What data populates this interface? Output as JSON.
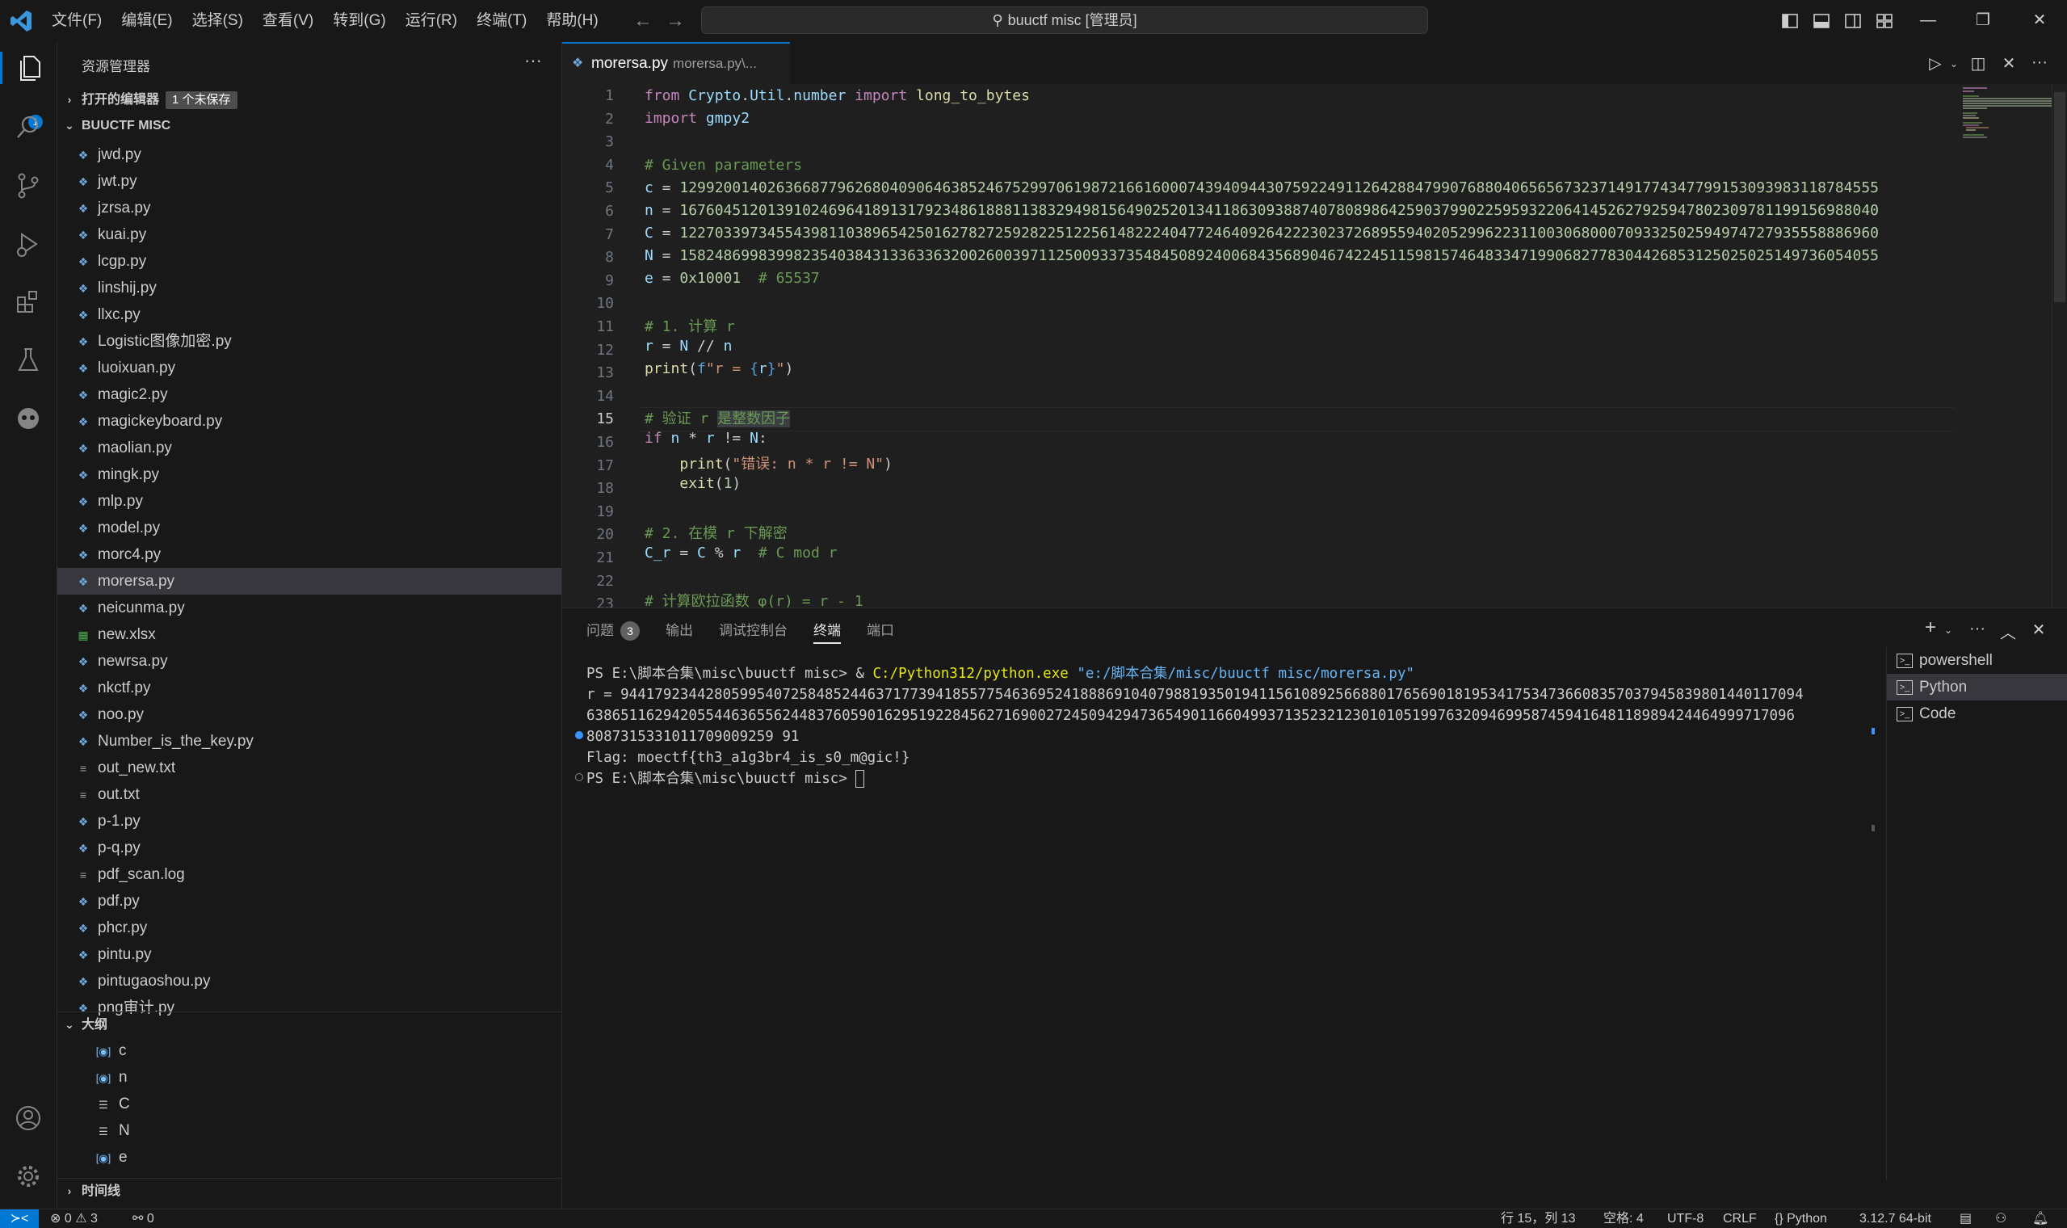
{
  "titlebar": {
    "menus": [
      "文件(F)",
      "编辑(E)",
      "选择(S)",
      "查看(V)",
      "转到(G)",
      "运行(R)",
      "终端(T)",
      "帮助(H)"
    ],
    "search_text": "buuctf misc [管理员]"
  },
  "activitybar": {
    "explorer_badge": "1"
  },
  "sidebar": {
    "title": "资源管理器",
    "open_editors_label": "打开的编辑器",
    "unsaved_badge": "1 个未保存",
    "folder_name": "BUUCTF MISC",
    "files": [
      {
        "name": "jwd.py",
        "type": "py"
      },
      {
        "name": "jwt.py",
        "type": "py"
      },
      {
        "name": "jzrsa.py",
        "type": "py"
      },
      {
        "name": "kuai.py",
        "type": "py"
      },
      {
        "name": "lcgp.py",
        "type": "py"
      },
      {
        "name": "linshij.py",
        "type": "py"
      },
      {
        "name": "llxc.py",
        "type": "py"
      },
      {
        "name": "Logistic图像加密.py",
        "type": "py"
      },
      {
        "name": "luoixuan.py",
        "type": "py"
      },
      {
        "name": "magic2.py",
        "type": "py"
      },
      {
        "name": "magickeyboard.py",
        "type": "py"
      },
      {
        "name": "maolian.py",
        "type": "py"
      },
      {
        "name": "mingk.py",
        "type": "py"
      },
      {
        "name": "mlp.py",
        "type": "py"
      },
      {
        "name": "model.py",
        "type": "py"
      },
      {
        "name": "morc4.py",
        "type": "py"
      },
      {
        "name": "morersa.py",
        "type": "py",
        "active": true
      },
      {
        "name": "neicunma.py",
        "type": "py"
      },
      {
        "name": "new.xlsx",
        "type": "xlsx"
      },
      {
        "name": "newrsa.py",
        "type": "py"
      },
      {
        "name": "nkctf.py",
        "type": "py"
      },
      {
        "name": "noo.py",
        "type": "py"
      },
      {
        "name": "Number_is_the_key.py",
        "type": "py"
      },
      {
        "name": "out_new.txt",
        "type": "txt"
      },
      {
        "name": "out.txt",
        "type": "txt"
      },
      {
        "name": "p-1.py",
        "type": "py"
      },
      {
        "name": "p-q.py",
        "type": "py"
      },
      {
        "name": "pdf_scan.log",
        "type": "txt"
      },
      {
        "name": "pdf.py",
        "type": "py"
      },
      {
        "name": "phcr.py",
        "type": "py"
      },
      {
        "name": "pintu.py",
        "type": "py"
      },
      {
        "name": "pintugaoshou.py",
        "type": "py"
      },
      {
        "name": "png审计.py",
        "type": "py"
      }
    ],
    "outline_label": "大纲",
    "outline": [
      {
        "name": "c",
        "kind": "var"
      },
      {
        "name": "n",
        "kind": "var"
      },
      {
        "name": "C",
        "kind": "const"
      },
      {
        "name": "N",
        "kind": "const"
      },
      {
        "name": "e",
        "kind": "var"
      }
    ],
    "timeline_label": "时间线"
  },
  "editor": {
    "tab_name": "morersa.py",
    "tab_desc": "morersa.py\\...",
    "current_line": 15,
    "line_numbers": [
      "1",
      "2",
      "3",
      "4",
      "5",
      "6",
      "7",
      "8",
      "9",
      "10",
      "11",
      "12",
      "13",
      "14",
      "15",
      "16",
      "17",
      "18",
      "19",
      "20",
      "21",
      "22",
      "23"
    ]
  },
  "panel": {
    "tabs": [
      "问题",
      "输出",
      "调试控制台",
      "终端",
      "端口"
    ],
    "problems_count": "3",
    "active_tab": "终端",
    "terminal_lines": {
      "cmd_prompt": "PS E:\\脚本合集\\misc\\buuctf misc> & ",
      "cmd_exe": "C:/Python312/python.exe",
      "cmd_arg": " \"e:/脚本合集/misc/buuctf misc/morersa.py\"",
      "r1": "r = 9441792344280599540725848524463717739418557754636952418886910407988193501941156108925668801765690181953417534736608357037945839801440117094",
      "r2": "6386511629420554463655624483760590162951922845627169002724509429473654901166049937135232123010105199763209469958745941648118989424464999717096",
      "r3": "8087315331011709009259 91",
      "flag": "Flag: moectf{th3_a1g3br4_is_s0_m@gic!}",
      "prompt2": "PS E:\\脚本合集\\misc\\buuctf misc> "
    },
    "terminals": [
      "powershell",
      "Python",
      "Code"
    ]
  },
  "statusbar": {
    "errors": "⊗ 0 ⚠ 3",
    "ports": "⚯ 0",
    "position": "行 15，列 13",
    "spaces": "空格: 4",
    "encoding": "UTF-8",
    "eol": "CRLF",
    "language": "{} Python",
    "interpreter": "3.12.7 64-bit"
  }
}
